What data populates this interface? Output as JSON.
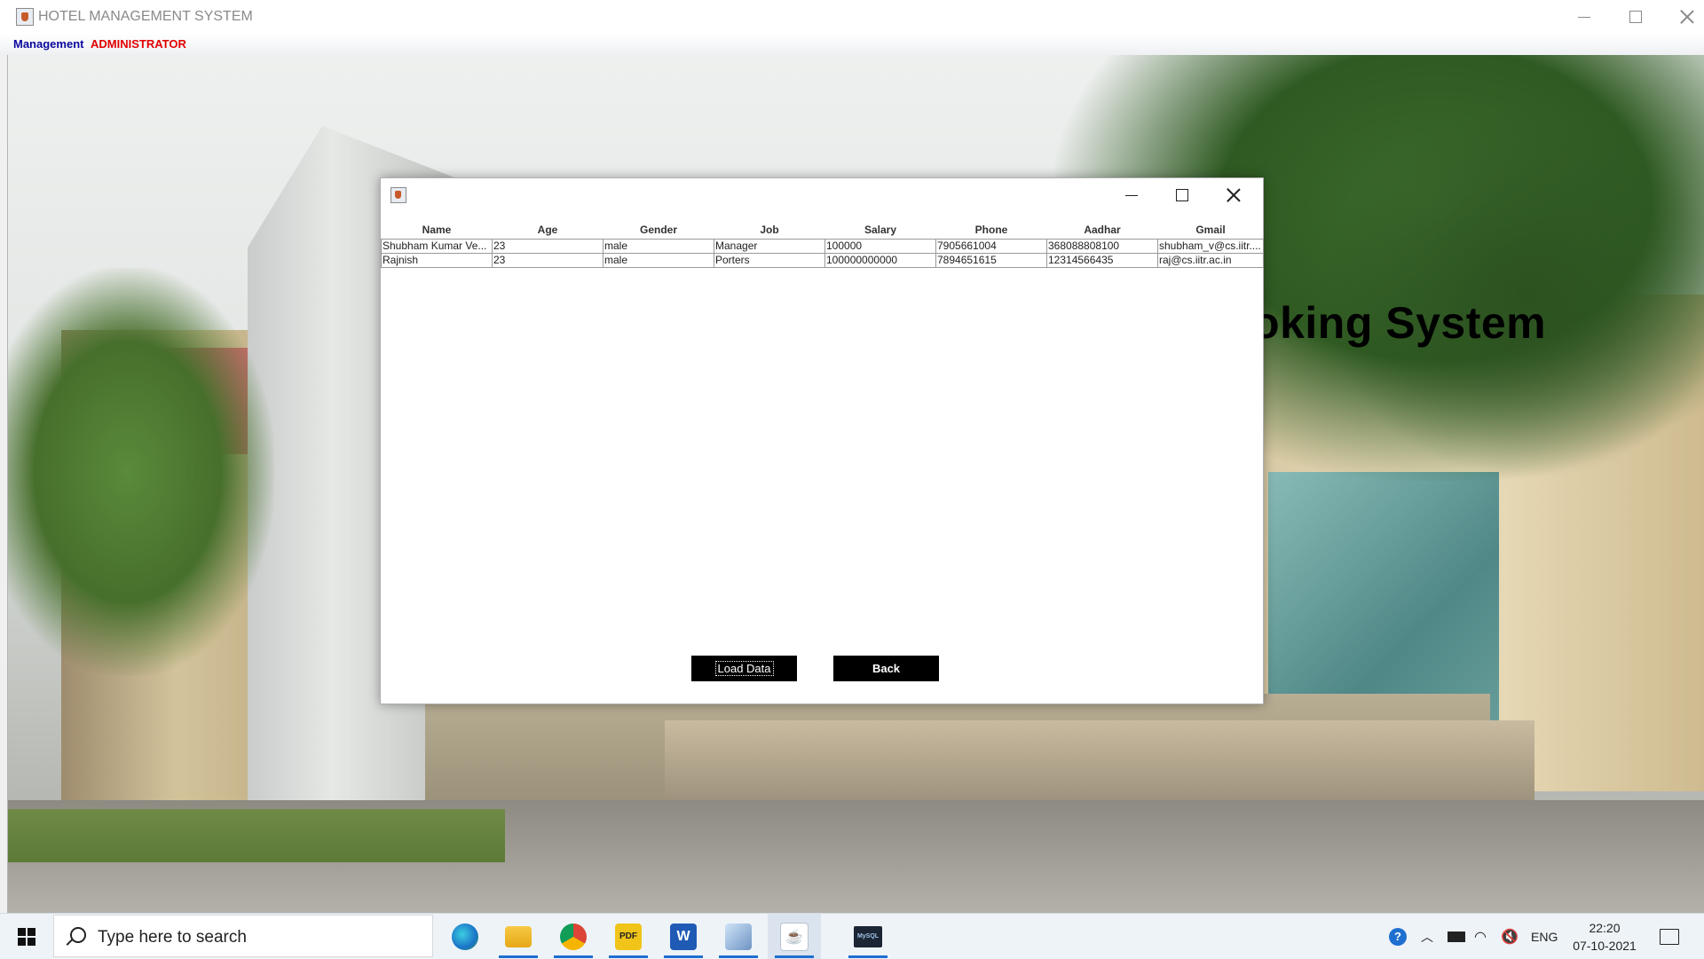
{
  "main_window": {
    "title": "HOTEL MANAGEMENT SYSTEM",
    "menu": {
      "management": "Management",
      "administrator": "ADMINISTRATOR"
    },
    "background_heading": "ooking System"
  },
  "dialog": {
    "columns": [
      "Name",
      "Age",
      "Gender",
      "Job",
      "Salary",
      "Phone",
      "Aadhar",
      "Gmail"
    ],
    "rows": [
      [
        "Shubham Kumar Ve...",
        "23",
        "male",
        "Manager",
        "100000",
        "7905661004",
        "368088808100",
        "shubham_v@cs.iitr...."
      ],
      [
        "Rajnish",
        "23",
        "male",
        "Porters",
        "100000000000",
        "7894651615",
        "12314566435",
        "raj@cs.iitr.ac.in"
      ]
    ],
    "buttons": {
      "load": "Load Data",
      "back": "Back"
    }
  },
  "taskbar": {
    "search_placeholder": "Type here to search",
    "apps": [
      "edge-icon",
      "file-explorer-icon",
      "chrome-icon",
      "pdf-icon",
      "word-icon",
      "box-app-icon",
      "java-icon",
      "mysql-icon"
    ],
    "word_glyph": "W",
    "pdf_glyph": "PDF",
    "mysql_glyph": "MySQL",
    "language": "ENG",
    "time": "22:20",
    "date": "07-10-2021"
  },
  "colors": {
    "menu_management": "#0a0a9e",
    "menu_administrator": "#e00000",
    "button_bg": "#000000",
    "button_text": "#ffffff",
    "taskbar_bg": "#eef3f8",
    "active_indicator": "#1e6fd0"
  }
}
